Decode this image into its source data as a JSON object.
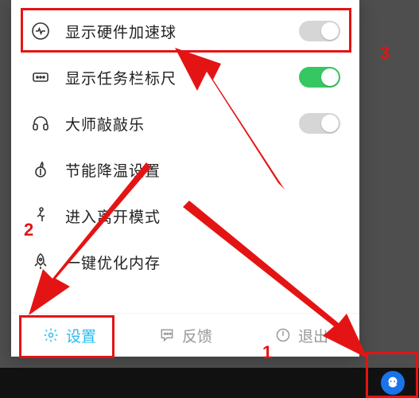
{
  "menu": {
    "items": [
      {
        "id": "hw-accel-ball",
        "label": "显示硬件加速球",
        "icon": "heartbeat-icon",
        "toggle": "off"
      },
      {
        "id": "taskbar-ruler",
        "label": "显示任务栏标尺",
        "icon": "dots-box-icon",
        "toggle": "on"
      },
      {
        "id": "master-knock",
        "label": "大师敲敲乐",
        "icon": "headset-icon",
        "toggle": "off"
      },
      {
        "id": "energy-cooling",
        "label": "节能降温设置",
        "icon": "leaf-icon",
        "toggle": null
      },
      {
        "id": "away-mode",
        "label": "进入离开模式",
        "icon": "walk-icon",
        "toggle": null
      },
      {
        "id": "optimize-mem",
        "label": "一键优化内存",
        "icon": "rocket-icon",
        "toggle": null
      }
    ]
  },
  "footer": {
    "settings": "设置",
    "feedback": "反馈",
    "exit": "退出"
  },
  "annotations": {
    "n1": "1",
    "n2": "2",
    "n3": "3"
  },
  "tray": {
    "icon": "ludashi-icon"
  }
}
